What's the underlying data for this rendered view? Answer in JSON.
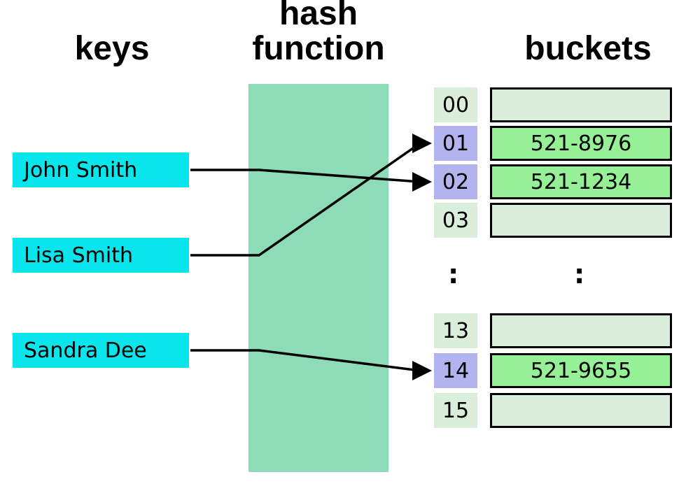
{
  "headers": {
    "keys": "keys",
    "hash": "hash function",
    "buckets": "buckets"
  },
  "keys": [
    {
      "name": "John Smith"
    },
    {
      "name": "Lisa Smith"
    },
    {
      "name": "Sandra Dee"
    }
  ],
  "ellipsis": ":",
  "buckets_top": [
    {
      "idx": "00",
      "value": "",
      "filled": false
    },
    {
      "idx": "01",
      "value": "521-8976",
      "filled": true
    },
    {
      "idx": "02",
      "value": "521-1234",
      "filled": true
    },
    {
      "idx": "03",
      "value": "",
      "filled": false
    }
  ],
  "buckets_bottom": [
    {
      "idx": "13",
      "value": "",
      "filled": false
    },
    {
      "idx": "14",
      "value": "521-9655",
      "filled": true
    },
    {
      "idx": "15",
      "value": "",
      "filled": false
    }
  ],
  "mapping": [
    {
      "key": "John Smith",
      "bucket_index": "02",
      "value": "521-1234"
    },
    {
      "key": "Lisa Smith",
      "bucket_index": "01",
      "value": "521-8976"
    },
    {
      "key": "Sandra Dee",
      "bucket_index": "14",
      "value": "521-9655"
    }
  ],
  "colors": {
    "key_bg": "#08e6ec",
    "hash_bg": "#8edbb8",
    "idx_default": "#dbeedb",
    "idx_selected": "#b3b3f0",
    "bucket_empty": "#dbeedb",
    "bucket_filled": "#96f096"
  }
}
